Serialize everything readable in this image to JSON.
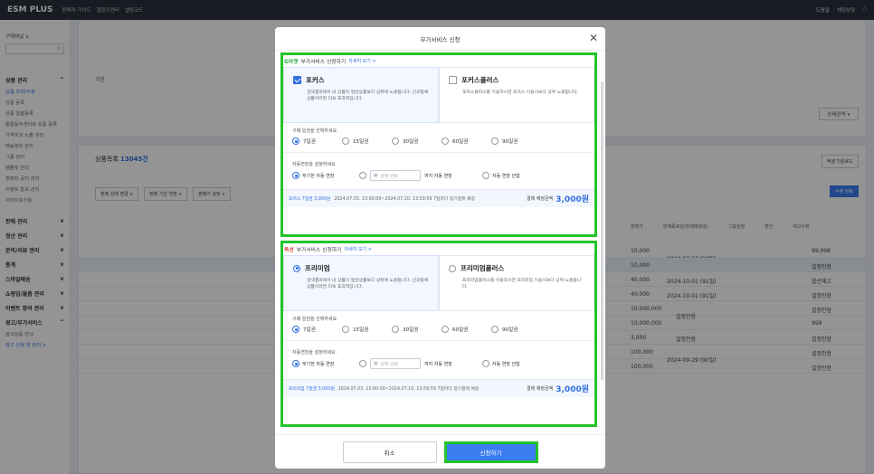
{
  "app": {
    "logo": "ESM PLUS",
    "top_links": [
      "판매자 가이드",
      "챌린지센터",
      "셀링코드"
    ],
    "top_right": [
      "도움말",
      "채팅상담"
    ]
  },
  "sidebar": {
    "selector": "구매채널 ∨",
    "groups": [
      {
        "label": "상품 관리",
        "expanded": true
      },
      {
        "label": "판매 관리"
      },
      {
        "label": "정산 관리"
      },
      {
        "label": "문의/리뷰 관리"
      },
      {
        "label": "통계"
      },
      {
        "label": "스마일배송"
      },
      {
        "label": "쇼핑업/물품 관리"
      },
      {
        "label": "이벤트 참여 관리"
      },
      {
        "label": "광고/부가서비스",
        "expanded": true
      }
    ],
    "items": [
      "상품 조회/수정",
      "상품 등록",
      "상품 일괄등록",
      "통합동주센터로 상품 등록",
      "가격비교 노출 관리",
      "배송정보 관리",
      "그룹 관리",
      "템플릿 관리",
      "판매자 공지 관리",
      "이벤트 홍보 관리",
      "이미지호스팅"
    ],
    "sub_items": [
      "광고상품 안내",
      "광고 신청 및 관리 >"
    ]
  },
  "background": {
    "list_title": "상품목록",
    "list_count": "13045건",
    "period_label": "기간",
    "search_btn": "수정 완료",
    "detail_btn": "상세검색 ∨",
    "excel_btn": "엑셀 다운로드",
    "filters": [
      "판매 상태 변경 ∨",
      "판매 기간 연장 ∨",
      "판매가 설정 ∨"
    ],
    "col_headers": [
      "판매가",
      "판매종료일(판매예정일)",
      "그룹설정",
      "할인",
      "재고수량"
    ],
    "rows": [
      {
        "price": "10,000",
        "date": "2024-07-12 (10일)",
        "stock": "99,998"
      },
      {
        "price": "10,000",
        "date": "",
        "stock": "설정안함"
      },
      {
        "price": "40,000",
        "date": "2024-10-01 (91일)",
        "stock": "옵션재고"
      },
      {
        "price": "40,000",
        "date": "2024-10-01 (91일)",
        "stock": "설정안함"
      },
      {
        "price": "10,000,000",
        "date": "설정안함",
        "stock": "설정안함"
      },
      {
        "price": "10,000,000",
        "date": "",
        "stock": "999"
      },
      {
        "price": "3,000",
        "date": "설정안함",
        "stock": "설정안함"
      },
      {
        "price": "100,000",
        "date": "2024-09-29 (90일)",
        "stock": "설정안함"
      },
      {
        "price": "100,000",
        "date": "",
        "stock": "설정안함"
      }
    ]
  },
  "modal": {
    "title": "부가서비스 신청",
    "close_icon": "close-icon",
    "gmarket": {
      "brand": "G마켓",
      "title": "부가서비스 신청하기",
      "link": "자세히 보기 >",
      "plans": [
        {
          "name": "포커스",
          "desc": "검색결과에서 내 상품이 일반상품보다 상위에 노출됩니다. 신규등록상품이라면 더욱 효과적입니다.",
          "checked": true
        },
        {
          "name": "포커스플러스",
          "desc": "포커스플러스를 이용하시면 포커스 이용시보다 상위 노출됩니다.",
          "checked": false
        }
      ],
      "period_label": "구매 일권을 선택하세요.",
      "periods": [
        "7일권",
        "15일권",
        "30일권",
        "60일권",
        "90일권"
      ],
      "selected_period": 0,
      "auto_label": "자동연장을 설정하세요.",
      "auto_opt1": "무기한 자동 연장",
      "date_placeholder": "날짜 선택",
      "auto_until": "까지 자동 연장",
      "auto_opt3": "자동 연장 안함",
      "summary_plan": "포커스 7일권 3,000원",
      "summary_text": "2024.07.03. 13:00:00~2024.07.10. 13:59:59 7일마다 정기결제 예정",
      "total_label": "결제 예정금액",
      "total_amount": "3,000원"
    },
    "auction": {
      "brand": "옥션",
      "title": "부가서비스 신청하기",
      "link": "자세히 보기 >",
      "plans": [
        {
          "name": "프리미엄",
          "desc": "검색결과에서 내 상품이 일반상품보다 상위에 노출됩니다. 신규등록상품이라면 더욱 효과적입니다.",
          "checked": true
        },
        {
          "name": "프리미엄플러스",
          "desc": "프리미엄플러스를 이용하시면 프리미엄 이용시보다 상위 노출됩니다.",
          "checked": false
        }
      ],
      "period_label": "구매 일권을 선택하세요.",
      "periods": [
        "7일권",
        "15일권",
        "30일권",
        "60일권",
        "90일권"
      ],
      "selected_period": 0,
      "auto_label": "자동연장을 설정하세요.",
      "auto_opt1": "무기한 자동 연장",
      "date_placeholder": "날짜 선택",
      "auto_until": "까지 자동 연장",
      "auto_opt3": "자동 연장 안함",
      "summary_plan": "프리미엄 7일권 3,000원",
      "summary_text": "2024.07.03. 13:00:00~2024.07.10. 13:59:59 7일마다 정기결제 예정",
      "total_label": "결제 예정금액",
      "total_amount": "3,000원"
    },
    "cancel_label": "취소",
    "apply_label": "신청하기"
  },
  "colors": {
    "accent": "#2f6fe0",
    "highlight": "#22c42a",
    "topbar": "#2a2f3a"
  }
}
